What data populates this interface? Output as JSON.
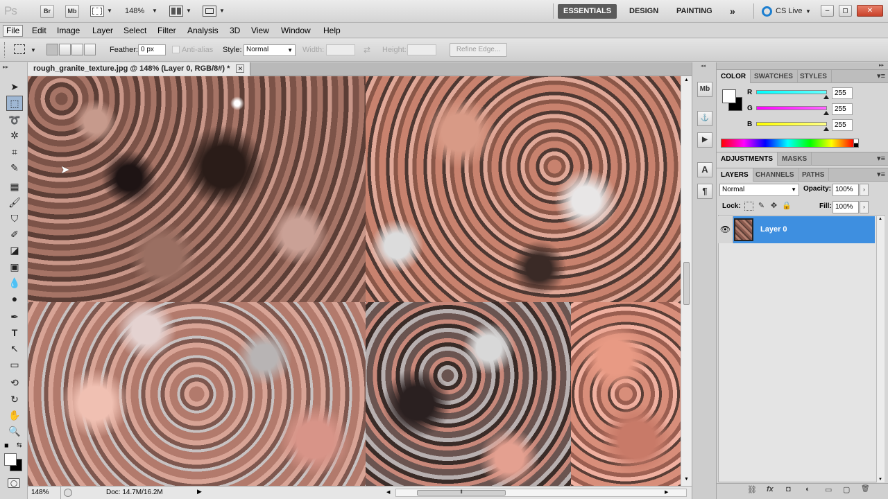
{
  "app": {
    "logo": "Ps",
    "bridge_label": "Br",
    "minibridge_label": "Mb",
    "zoom": "148%",
    "workspaces": [
      "ESSENTIALS",
      "DESIGN",
      "PAINTING"
    ],
    "more_workspaces": "»",
    "cs_live": "CS Live",
    "window_minimize": "–",
    "window_restore": "◻",
    "window_close": "✕"
  },
  "menu": [
    "File",
    "Edit",
    "Image",
    "Layer",
    "Select",
    "Filter",
    "Analysis",
    "3D",
    "View",
    "Window",
    "Help"
  ],
  "options": {
    "feather_label": "Feather:",
    "feather_value": "0 px",
    "antialias_label": "Anti-alias",
    "style_label": "Style:",
    "style_value": "Normal",
    "width_label": "Width:",
    "height_label": "Height:",
    "refine_edge": "Refine Edge..."
  },
  "document": {
    "tab_title": "rough_granite_texture.jpg @ 148% (Layer 0, RGB/8#) *",
    "tab_close": "✕"
  },
  "status": {
    "zoom": "148%",
    "doc_size": "Doc: 14.7M/16.2M",
    "scroll_grip": "⦀"
  },
  "dock_icons": [
    {
      "label": "Mb",
      "icon": "minibridge-icon"
    },
    {
      "label": "⚓",
      "icon": "history-icon"
    },
    {
      "label": "▶",
      "icon": "actions-icon"
    },
    {
      "label": "A",
      "icon": "character-icon"
    },
    {
      "label": "¶",
      "icon": "paragraph-icon"
    }
  ],
  "color_panel": {
    "tabs": [
      "COLOR",
      "SWATCHES",
      "STYLES"
    ],
    "channels": [
      {
        "name": "R",
        "value": "255",
        "color": "#00e5ff"
      },
      {
        "name": "G",
        "value": "255",
        "color": "#ff00ff"
      },
      {
        "name": "B",
        "value": "255",
        "color": "#ffff00"
      }
    ]
  },
  "adjustments_panel": {
    "tabs": [
      "ADJUSTMENTS",
      "MASKS"
    ]
  },
  "layers_panel": {
    "tabs": [
      "LAYERS",
      "CHANNELS",
      "PATHS"
    ],
    "blend_mode": "Normal",
    "opacity_label": "Opacity:",
    "opacity_value": "100%",
    "lock_label": "Lock:",
    "fill_label": "Fill:",
    "fill_value": "100%",
    "layers": [
      {
        "name": "Layer 0"
      }
    ],
    "footer_icons": [
      "link-icon",
      "fx-icon",
      "mask-icon",
      "adjustment-icon",
      "group-icon",
      "new-layer-icon",
      "trash-icon"
    ],
    "footer_glyphs": [
      "⛓",
      "fx",
      "◘",
      "◐",
      "▭",
      "▢",
      "🗑"
    ]
  },
  "colors": {
    "accent": "#3e8fe0",
    "workspace_active": "#5a5a5a"
  }
}
